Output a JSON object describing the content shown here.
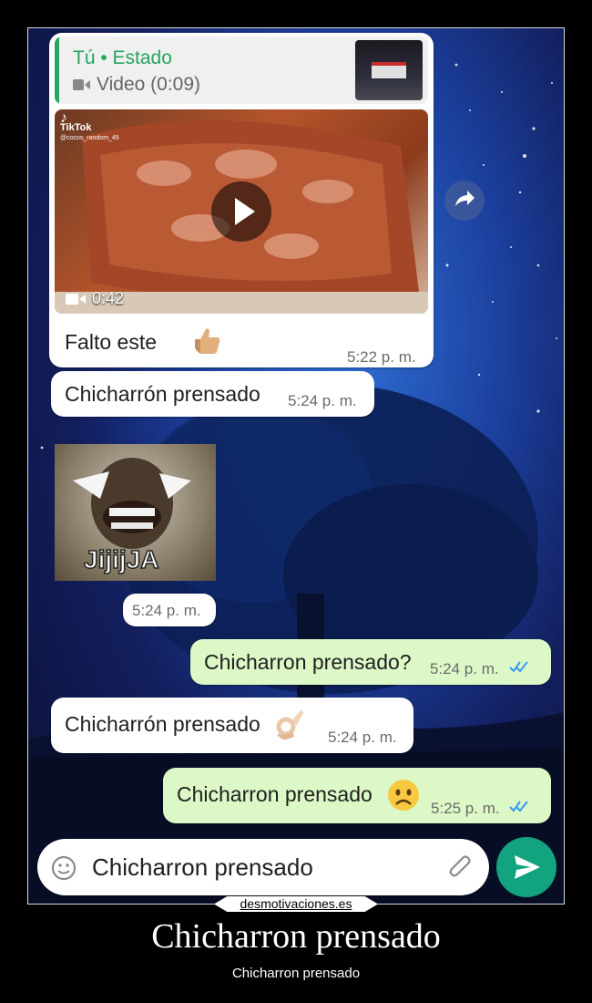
{
  "reply_quote": {
    "author": "Tú • Estado",
    "media_label": "Video (0:09)"
  },
  "video": {
    "platform": "TikTok",
    "handle": "@cocos_random_45",
    "duration": "0:42"
  },
  "messages": [
    {
      "text": "Falto este",
      "time": "5:22 p. m.",
      "direction": "in",
      "emoji": "thumbs-up"
    },
    {
      "text": "Chicharrón prensado",
      "time": "5:24 p. m.",
      "direction": "in"
    },
    {
      "sticker_caption": "JijijJA",
      "time": "5:24 p. m.",
      "direction": "in"
    },
    {
      "text": "Chicharron prensado?",
      "time": "5:24 p. m.",
      "direction": "out",
      "status": "read"
    },
    {
      "text": "Chicharrón prensado",
      "time": "5:24 p. m.",
      "direction": "in",
      "emoji": "ok-hand"
    },
    {
      "text": "Chicharron prensado",
      "time": "5:25 p. m.",
      "direction": "out",
      "status": "read",
      "emoji": "frowning-face"
    }
  ],
  "composer": {
    "value": "Chicharron prensado"
  },
  "footer": {
    "site": "desmotivaciones.es",
    "title": "Chicharron prensado",
    "subtitle": "Chicharron prensado"
  },
  "colors": {
    "incoming_bubble": "#ffffff",
    "outgoing_bubble": "#dcf8c6",
    "accent_green": "#12a37f",
    "read_ticks": "#3497f9",
    "quote_bar": "#25a55f"
  }
}
